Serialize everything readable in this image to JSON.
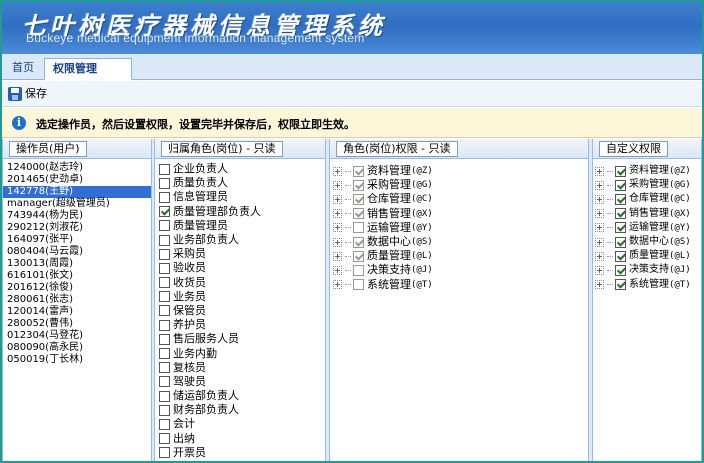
{
  "app": {
    "title": "七叶树医疗器械信息管理系统",
    "subtitle": "Buckeye medical equipment information management system"
  },
  "tabs": {
    "home": "首页",
    "active": "权限管理"
  },
  "toolbar": {
    "save_label": "保存",
    "save_icon": "save-icon"
  },
  "info": {
    "icon": "info-icon",
    "text": "选定操作员，然后设置权限，设置完毕并保存后，权限立即生效。"
  },
  "panels": {
    "users": {
      "title": "操作员(用户)",
      "items": [
        {
          "label": "124000(赵志玲)",
          "selected": false
        },
        {
          "label": "201465(史劲卓)",
          "selected": false
        },
        {
          "label": "142778(王野)",
          "selected": true
        },
        {
          "label": "manager(超级管理员)",
          "selected": false
        },
        {
          "label": "743944(杨为民)",
          "selected": false
        },
        {
          "label": "290212(刘淑花)",
          "selected": false
        },
        {
          "label": "164097(张平)",
          "selected": false
        },
        {
          "label": "080404(马云霞)",
          "selected": false
        },
        {
          "label": "130013(周霞)",
          "selected": false
        },
        {
          "label": "616101(张文)",
          "selected": false
        },
        {
          "label": "201612(徐俊)",
          "selected": false
        },
        {
          "label": "280061(张志)",
          "selected": false
        },
        {
          "label": "120014(雷声)",
          "selected": false
        },
        {
          "label": "280052(曹伟)",
          "selected": false
        },
        {
          "label": "012304(马登花)",
          "selected": false
        },
        {
          "label": "080090(高永民)",
          "selected": false
        },
        {
          "label": "050019(丁长林)",
          "selected": false
        }
      ]
    },
    "roles": {
      "title": "归属角色(岗位) - 只读",
      "items": [
        {
          "label": "企业负责人",
          "checked": false
        },
        {
          "label": "质量负责人",
          "checked": false
        },
        {
          "label": "信息管理员",
          "checked": false
        },
        {
          "label": "质量管理部负责人",
          "checked": true
        },
        {
          "label": "质量管理员",
          "checked": false
        },
        {
          "label": "业务部负责人",
          "checked": false
        },
        {
          "label": "采购员",
          "checked": false
        },
        {
          "label": "验收员",
          "checked": false
        },
        {
          "label": "收货员",
          "checked": false
        },
        {
          "label": "业务员",
          "checked": false
        },
        {
          "label": "保管员",
          "checked": false
        },
        {
          "label": "养护员",
          "checked": false
        },
        {
          "label": "售后服务人员",
          "checked": false
        },
        {
          "label": "业务内勤",
          "checked": false
        },
        {
          "label": "复核员",
          "checked": false
        },
        {
          "label": "驾驶员",
          "checked": false
        },
        {
          "label": "储运部负责人",
          "checked": false
        },
        {
          "label": "财务部负责人",
          "checked": false
        },
        {
          "label": "会计",
          "checked": false
        },
        {
          "label": "出纳",
          "checked": false
        },
        {
          "label": "开票员",
          "checked": false
        }
      ]
    },
    "perms": {
      "title": "角色(岗位)权限 - 只读",
      "items": [
        {
          "label": "资料管理",
          "code": "(@Z)",
          "checked": true
        },
        {
          "label": "采购管理",
          "code": "(@G)",
          "checked": true
        },
        {
          "label": "仓库管理",
          "code": "(@C)",
          "checked": true
        },
        {
          "label": "销售管理",
          "code": "(@X)",
          "checked": true
        },
        {
          "label": "运输管理",
          "code": "(@Y)",
          "checked": false
        },
        {
          "label": "数据中心",
          "code": "(@S)",
          "checked": true
        },
        {
          "label": "质量管理",
          "code": "(@L)",
          "checked": true
        },
        {
          "label": "决策支持",
          "code": "(@J)",
          "checked": false
        },
        {
          "label": "系统管理",
          "code": "(@T)",
          "checked": false
        }
      ]
    },
    "custom": {
      "title": "自定义权限",
      "items": [
        {
          "label": "资料管理",
          "code": "(@Z)",
          "checked": true
        },
        {
          "label": "采购管理",
          "code": "(@G)",
          "checked": true
        },
        {
          "label": "仓库管理",
          "code": "(@C)",
          "checked": true
        },
        {
          "label": "销售管理",
          "code": "(@X)",
          "checked": true
        },
        {
          "label": "运输管理",
          "code": "(@Y)",
          "checked": true
        },
        {
          "label": "数据中心",
          "code": "(@S)",
          "checked": true
        },
        {
          "label": "质量管理",
          "code": "(@L)",
          "checked": true
        },
        {
          "label": "决策支持",
          "code": "(@J)",
          "checked": true
        },
        {
          "label": "系统管理",
          "code": "(@T)",
          "checked": true
        }
      ]
    }
  }
}
